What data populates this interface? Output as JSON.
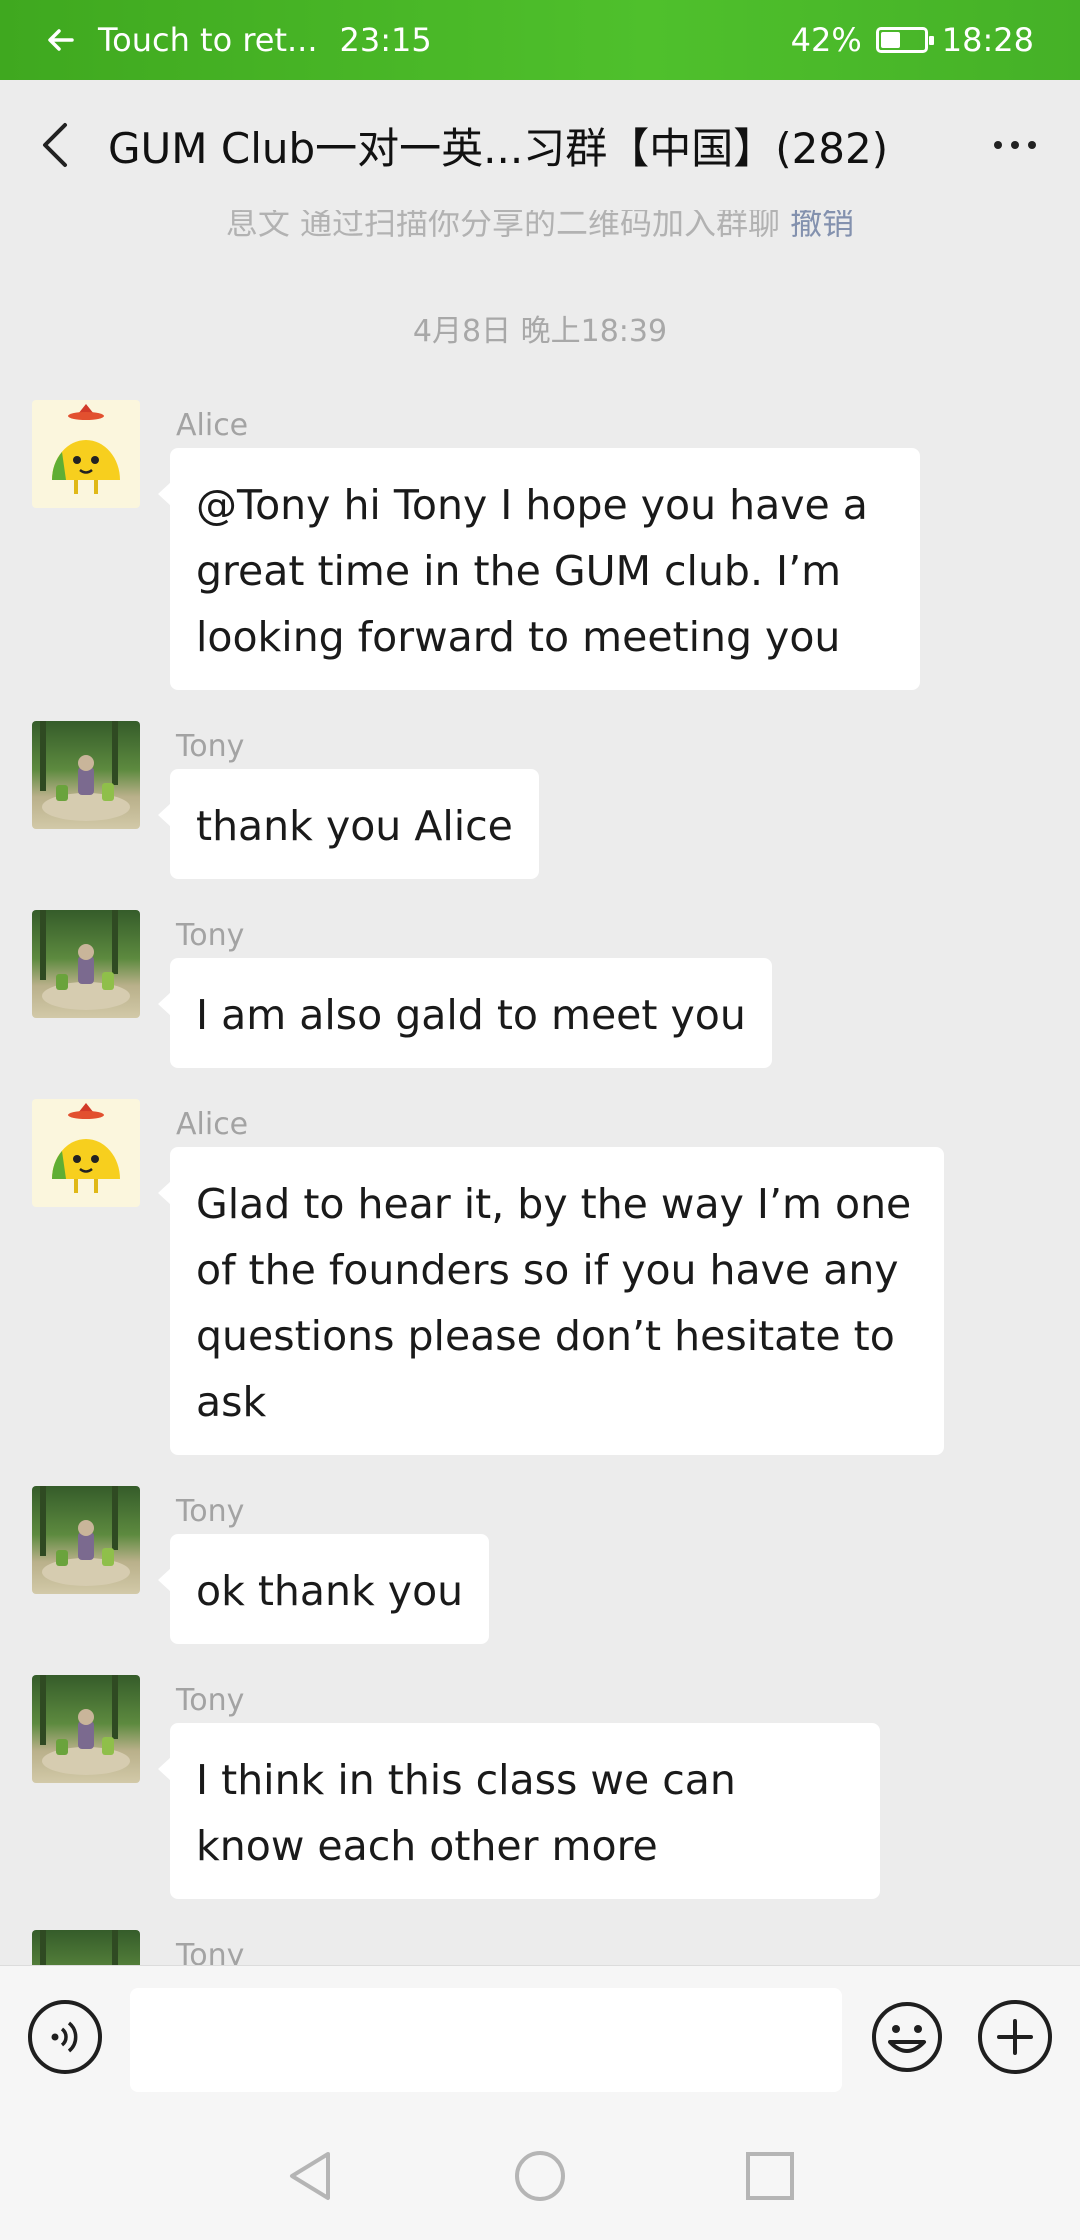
{
  "status_bar": {
    "back_label": "Touch to ret...",
    "call_time": "23:15",
    "battery": "42%",
    "battery_level": 0.42,
    "clock": "18:28"
  },
  "header": {
    "title": "GUM Club一对一英...习群【中国】(282)"
  },
  "system_note": {
    "text": "息文 通过扫描你分享的二维码加入群聊",
    "link": "撤销"
  },
  "timestamp": "4月8日 晚上18:39",
  "messages": [
    {
      "sender": "Alice",
      "avatar": "taco-avatar",
      "text": "@Tony hi Tony I hope you have a great time in the GUM club. I’m looking forward to meeting you"
    },
    {
      "sender": "Tony",
      "avatar": "garden-photo-avatar",
      "text": "thank you Alice"
    },
    {
      "sender": "Tony",
      "avatar": "garden-photo-avatar",
      "text": "I am also gald to meet you"
    },
    {
      "sender": "Alice",
      "avatar": "taco-avatar",
      "text": "Glad to hear it, by the way I’m one of the founders so if you have any questions please don’t hesitate to ask"
    },
    {
      "sender": "Tony",
      "avatar": "garden-photo-avatar",
      "text": "ok thank you"
    },
    {
      "sender": "Tony",
      "avatar": "garden-photo-avatar",
      "text": "I think in this class we can know each other more"
    },
    {
      "sender": "Tony",
      "avatar": "garden-photo-avatar",
      "text": ""
    }
  ],
  "input": {
    "value": "",
    "placeholder": ""
  },
  "colors": {
    "status_green": "#4fc02c",
    "chat_bg": "#ececec",
    "link_blue": "#576b95"
  }
}
